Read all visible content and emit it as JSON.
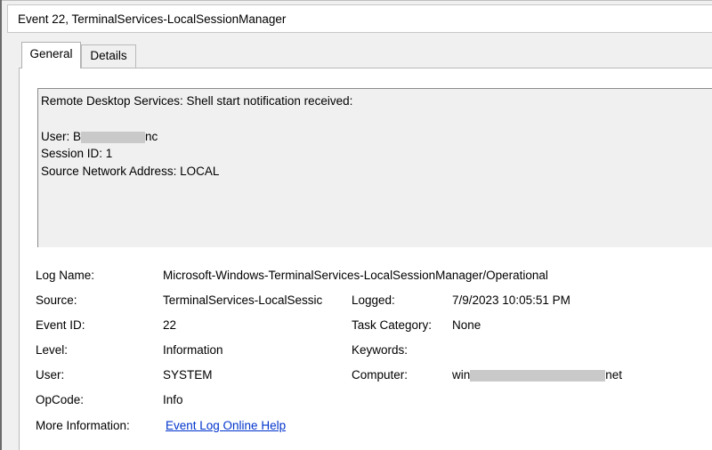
{
  "window": {
    "title": "Event 22, TerminalServices-LocalSessionManager"
  },
  "tabs": [
    {
      "label": "General",
      "active": true
    },
    {
      "label": "Details",
      "active": false
    }
  ],
  "description": {
    "line1": "Remote Desktop Services: Shell start notification received:",
    "user_prefix": "User: B",
    "user_suffix": "nc",
    "session": "Session ID: 1",
    "source_address": "Source Network Address: LOCAL"
  },
  "fields": {
    "log_name": {
      "label": "Log Name:",
      "value": "Microsoft-Windows-TerminalServices-LocalSessionManager/Operational"
    },
    "source": {
      "label": "Source:",
      "value": "TerminalServices-LocalSessic"
    },
    "logged": {
      "label": "Logged:",
      "value": "7/9/2023 10:05:51 PM"
    },
    "event_id": {
      "label": "Event ID:",
      "value": "22"
    },
    "task_category": {
      "label": "Task Category:",
      "value": "None"
    },
    "level": {
      "label": "Level:",
      "value": "Information"
    },
    "keywords": {
      "label": "Keywords:",
      "value": ""
    },
    "user": {
      "label": "User:",
      "value": "SYSTEM"
    },
    "computer": {
      "label": "Computer:",
      "prefix": "win",
      "suffix": "net"
    },
    "opcode": {
      "label": "OpCode:",
      "value": "Info"
    },
    "more_info": {
      "label": "More Information:",
      "link": "Event Log Online Help"
    }
  },
  "colors": {
    "link": "#0033cc",
    "redaction": "#c9c9c9",
    "background": "#f0f0f0"
  }
}
